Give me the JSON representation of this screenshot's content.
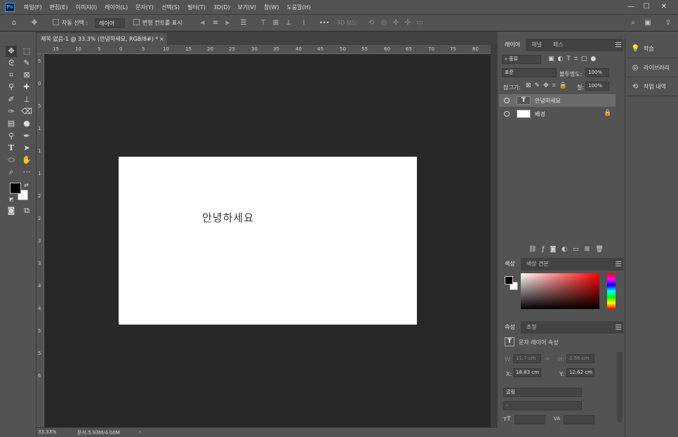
{
  "app": {
    "logo": "Ps"
  },
  "menu": [
    "파일(F)",
    "편집(E)",
    "이미지(I)",
    "레이어(L)",
    "문자(Y)",
    "선택(S)",
    "필터(T)",
    "3D(D)",
    "보기(V)",
    "창(W)",
    "도움말(H)"
  ],
  "window_controls": {
    "minimize": "—",
    "maximize": "☐",
    "close": "✕"
  },
  "options": {
    "auto_select_label": "자동 선택 :",
    "auto_select_value": "레이어",
    "transform_label": "변형 컨트롤 표시",
    "mode_3d_label": "3D 모드:",
    "more": "•••"
  },
  "document": {
    "tab_title": "제목 없음-1 @ 33.3% (안녕하세요, RGB/8#) *",
    "close": "×",
    "canvas_text": "안녕하세요"
  },
  "rulers": {
    "h": [
      "15",
      "10",
      "5",
      "0",
      "5",
      "10",
      "15",
      "20",
      "25",
      "30",
      "35",
      "40",
      "45",
      "50",
      "55",
      "60",
      "65",
      "70",
      "75",
      "80"
    ],
    "v": [
      "5",
      "0",
      "5",
      "1",
      "1",
      "1",
      "2",
      "2",
      "3",
      "3",
      "4",
      "4",
      "5",
      "5",
      "6"
    ]
  },
  "status": {
    "zoom": "33.33%",
    "doc_size": "문서:5.93M/4.00M"
  },
  "layers_panel": {
    "tabs": [
      "레이어",
      "채널",
      "패스"
    ],
    "filter": "종류",
    "blend_mode": "표준",
    "opacity_label": "불투명도:",
    "opacity_value": "100%",
    "lock_label": "잠그기:",
    "fill_label": "칠:",
    "fill_value": "100%",
    "layers": [
      {
        "name": "안녕하세요",
        "type": "text",
        "visible": true,
        "selected": true
      },
      {
        "name": "배경",
        "type": "background",
        "visible": true,
        "locked": true
      }
    ],
    "text_layer_glyph": "T"
  },
  "color_panel": {
    "tabs": [
      "색상",
      "색상 견본"
    ],
    "foreground": "#000000",
    "background": "#ffffff",
    "hue": "#ff0000"
  },
  "properties_panel": {
    "tabs": [
      "속성",
      "조정"
    ],
    "title": "문자 레이어 속성",
    "w_label": "W:",
    "w_value": "11.7 cm",
    "h_label": "H:",
    "h_value": "2.56 cm",
    "x_label": "X:",
    "x_value": "18.83 cm",
    "y_label": "Y:",
    "y_value": "12.62 cm",
    "font": "굴림",
    "font_style": "-"
  },
  "right_column": [
    "학습",
    "라이브러리",
    "작업 내역"
  ]
}
